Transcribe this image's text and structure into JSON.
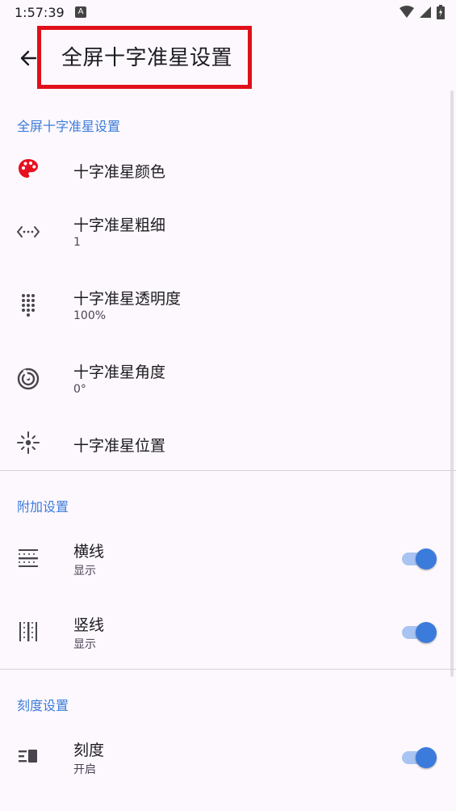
{
  "status": {
    "time": "1:57:39",
    "notif_letter": "A"
  },
  "header": {
    "title": "全屏十字准星设置"
  },
  "sections": [
    {
      "header": "全屏十字准星设置",
      "items": [
        {
          "label": "十字准星颜色",
          "icon": "palette-icon"
        },
        {
          "label": "十字准星粗细",
          "value": "1",
          "icon": "code-brackets-icon"
        },
        {
          "label": "十字准星透明度",
          "value": "100%",
          "icon": "dot-grid-icon"
        },
        {
          "label": "十字准星角度",
          "value": "0°",
          "icon": "target-icon"
        },
        {
          "label": "十字准星位置",
          "icon": "crosshair-icon"
        }
      ]
    },
    {
      "header": "附加设置",
      "items": [
        {
          "label": "横线",
          "value": "显示",
          "icon": "horizontal-lines-icon",
          "switch_on": true
        },
        {
          "label": "竖线",
          "value": "显示",
          "icon": "vertical-lines-icon",
          "switch_on": true
        }
      ]
    },
    {
      "header": "刻度设置",
      "items": [
        {
          "label": "刻度",
          "value": "开启",
          "icon": "ruler-icon",
          "switch_on": true
        }
      ]
    }
  ],
  "colors": {
    "accent": "#3B7BDB",
    "highlight": "#E0101A",
    "palette": "#E8101E"
  }
}
